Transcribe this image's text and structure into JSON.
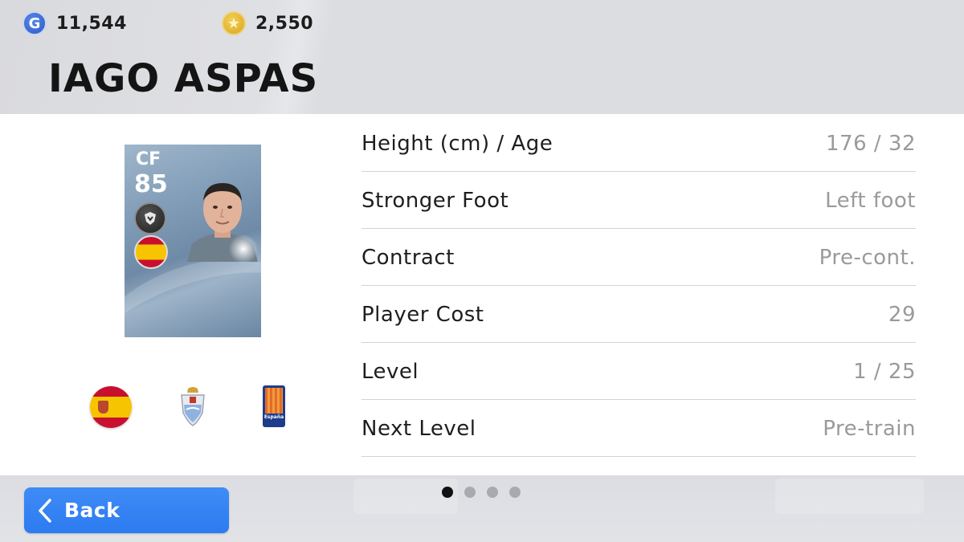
{
  "currency": {
    "gp": {
      "icon": "gp-coin-icon",
      "symbol": "G",
      "value": "11,544"
    },
    "coins": {
      "icon": "star-coin-icon",
      "symbol": "★",
      "value": "2,550"
    }
  },
  "player": {
    "name": "IAGO ASPAS",
    "card": {
      "position": "CF",
      "rating": "85",
      "badge_icon": "legend-badge-icon",
      "flag_icon": "spain-flag-icon"
    }
  },
  "badges": {
    "nationality": "spain-flag-icon",
    "club": "club-crest-icon",
    "league": {
      "icon": "league-logo-icon",
      "label": "España"
    }
  },
  "stats": [
    {
      "label": "Height (cm) / Age",
      "value": "176 / 32"
    },
    {
      "label": "Stronger Foot",
      "value": "Left foot"
    },
    {
      "label": "Contract",
      "value": "Pre-cont."
    },
    {
      "label": "Player Cost",
      "value": "29"
    },
    {
      "label": "Level",
      "value": "1 / 25"
    },
    {
      "label": "Next Level",
      "value": "Pre-train"
    }
  ],
  "footer": {
    "back_label": "Back",
    "back_icon": "chevron-left-icon",
    "page_dots": {
      "count": 4,
      "active": 1
    }
  },
  "colors": {
    "accent": "#2c7bf0",
    "header_bg": "#dcdde1",
    "value_text": "#9a9a9a"
  }
}
